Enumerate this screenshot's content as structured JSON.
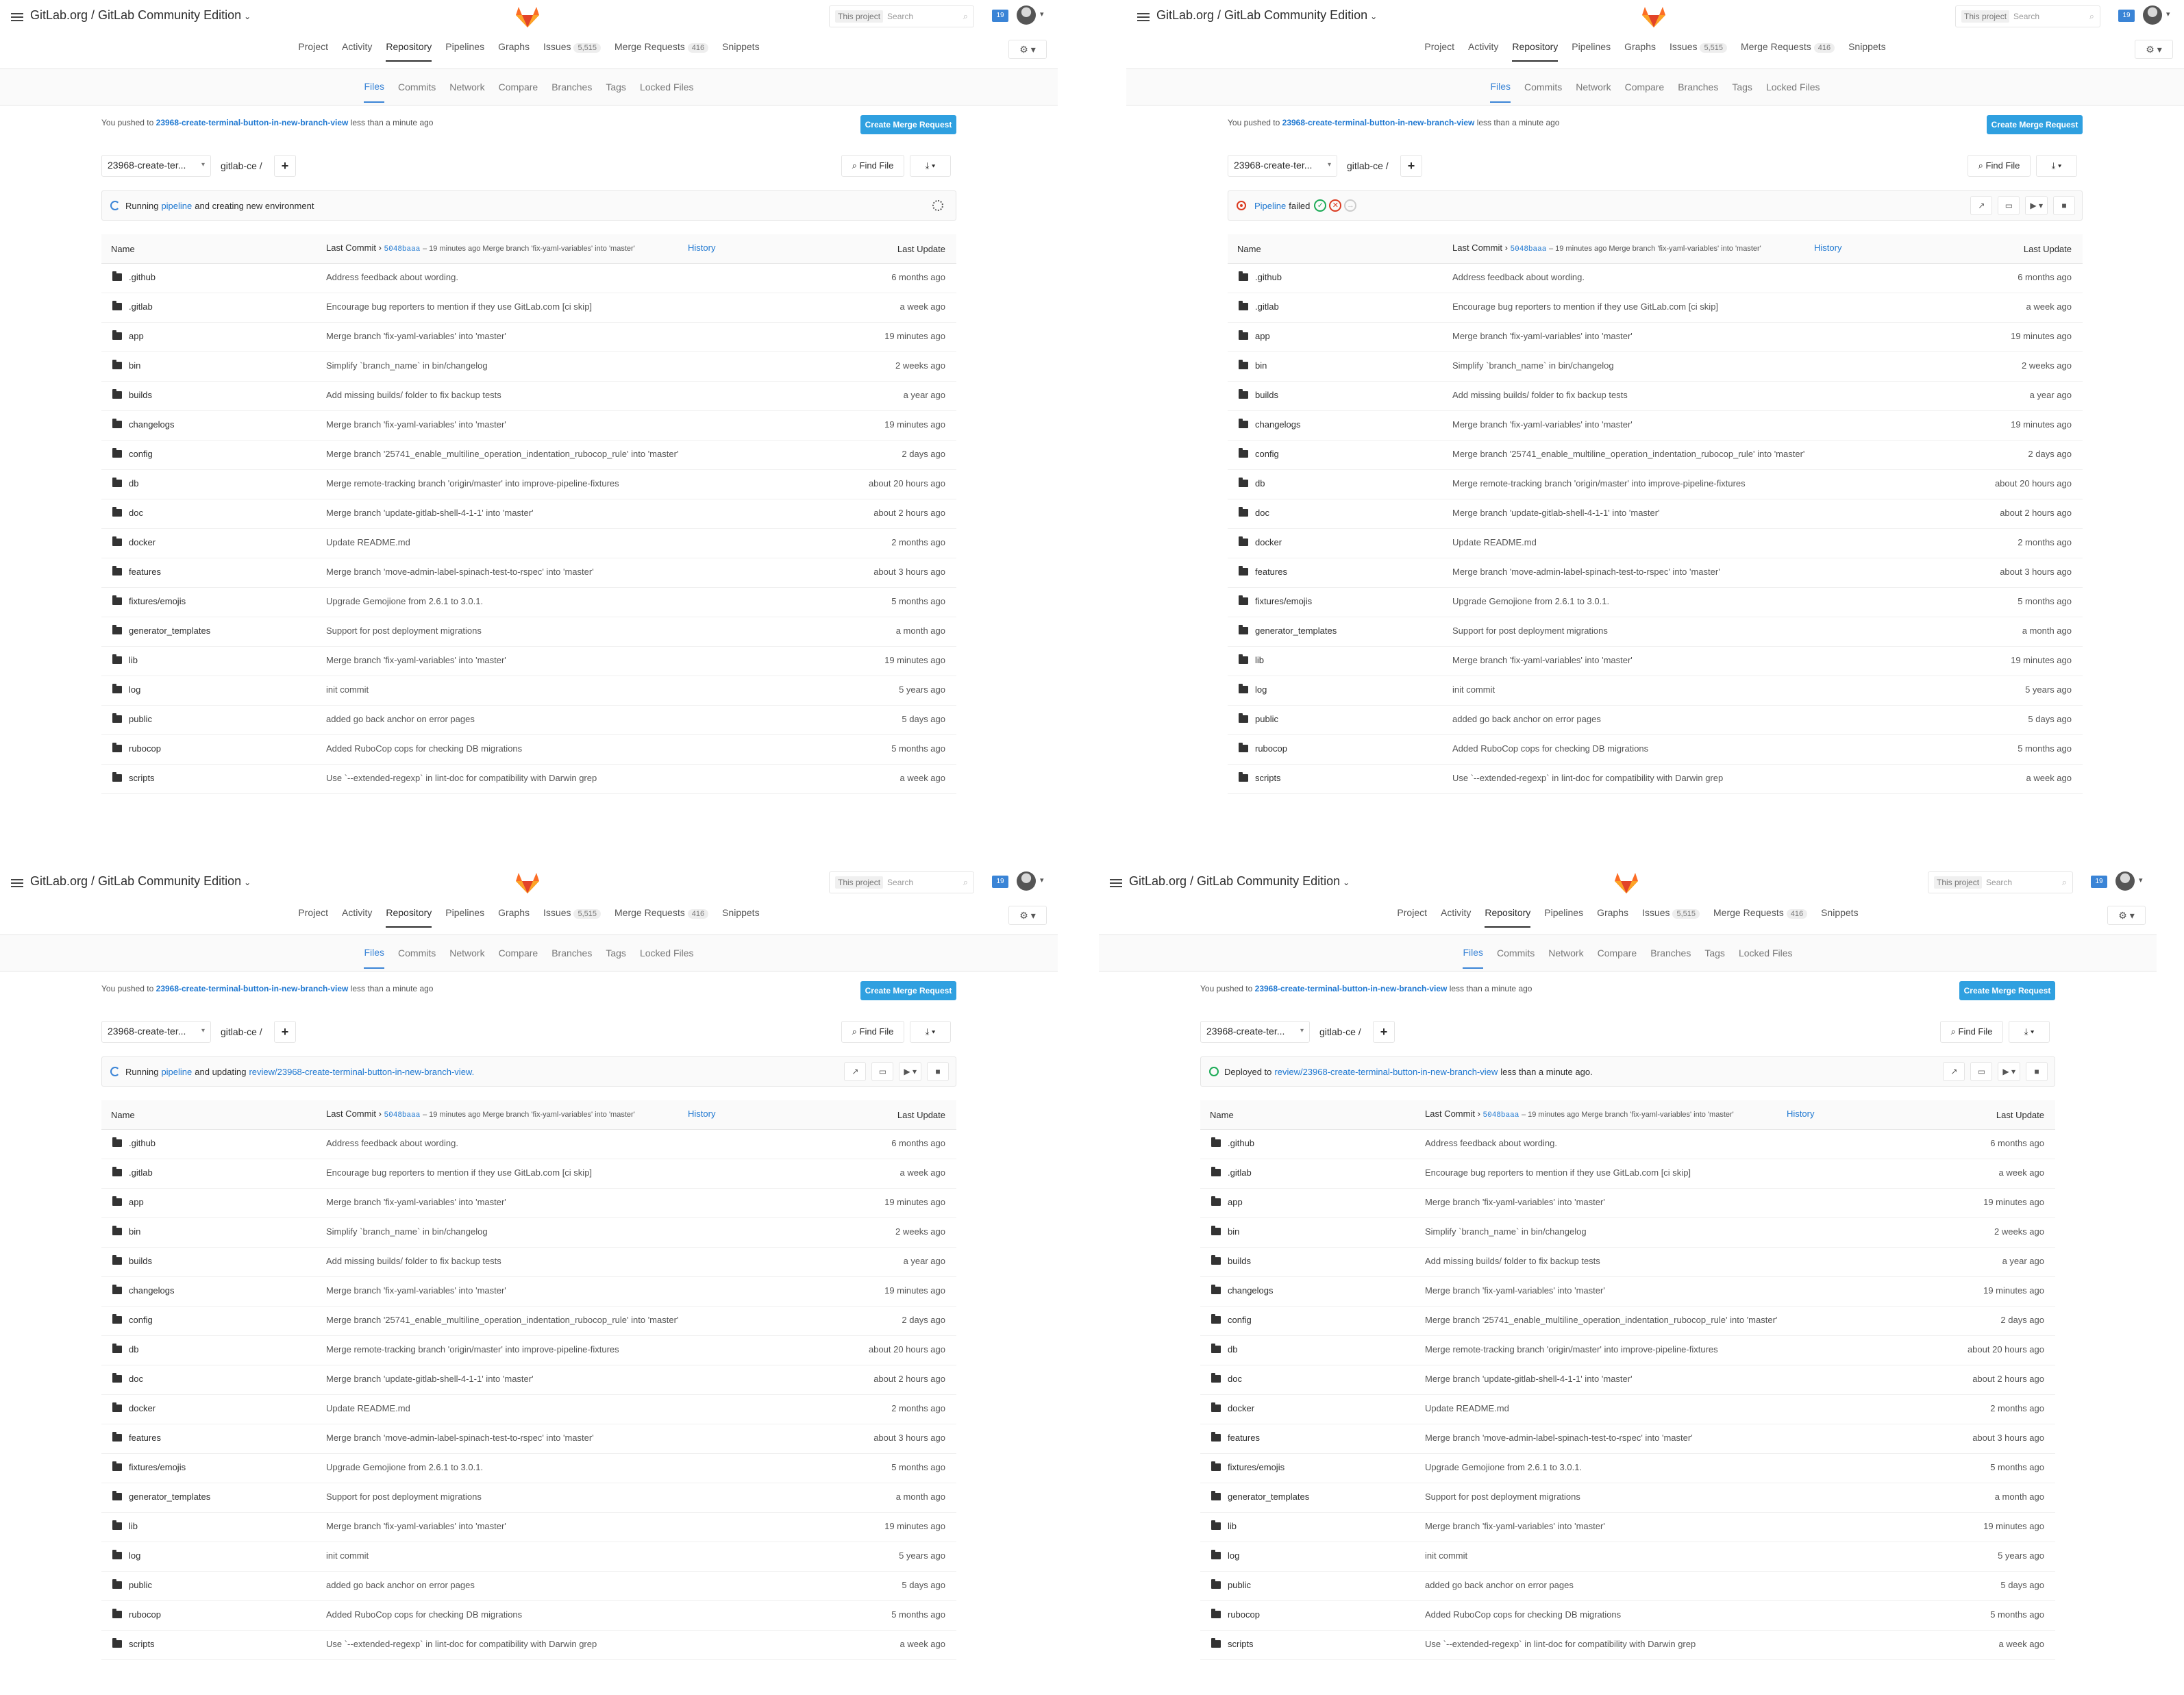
{
  "header": {
    "project_title": "GitLab.org / GitLab Community Edition",
    "search_scope": "This project",
    "search_placeholder": "Search",
    "todo_count": "19"
  },
  "nav": [
    {
      "label": "Project",
      "count": "",
      "active": false
    },
    {
      "label": "Activity",
      "count": "",
      "active": false
    },
    {
      "label": "Repository",
      "count": "",
      "active": true
    },
    {
      "label": "Pipelines",
      "count": "",
      "active": false
    },
    {
      "label": "Graphs",
      "count": "",
      "active": false
    },
    {
      "label": "Issues",
      "count": "5,515",
      "active": false
    },
    {
      "label": "Merge Requests",
      "count": "416",
      "active": false
    },
    {
      "label": "Snippets",
      "count": "",
      "active": false
    }
  ],
  "subnav": [
    {
      "label": "Files",
      "active": true
    },
    {
      "label": "Commits",
      "active": false
    },
    {
      "label": "Network",
      "active": false
    },
    {
      "label": "Compare",
      "active": false
    },
    {
      "label": "Branches",
      "active": false
    },
    {
      "label": "Tags",
      "active": false
    },
    {
      "label": "Locked Files",
      "active": false
    }
  ],
  "push_notice": {
    "prefix": "You pushed to",
    "branch": "23968-create-terminal-button-in-new-branch-view",
    "suffix": "less than a minute ago"
  },
  "create_mr_label": "Create Merge Request",
  "branch_selector": "23968-create-ter...",
  "path": "gitlab-ce /",
  "find_file_label": "Find File",
  "table_header": {
    "name": "Name",
    "last_commit": "Last Commit",
    "sha": "5048baaa",
    "commit_msg": "– 19 minutes ago Merge branch 'fix-yaml-variables' into 'master'",
    "history": "History",
    "last_update": "Last Update"
  },
  "status_panels": [
    {
      "type": "running",
      "text1": "Running",
      "link": "pipeline",
      "text2": "and creating new environment",
      "env_link": "",
      "text3": ""
    },
    {
      "type": "failed",
      "text1": "",
      "link": "Pipeline",
      "text2": "failed",
      "env_link": "",
      "text3": ""
    },
    {
      "type": "updating",
      "text1": "Running",
      "link": "pipeline",
      "text2": "and updating",
      "env_link": "review/23968-create-terminal-button-in-new-branch-view.",
      "text3": ""
    },
    {
      "type": "deployed",
      "text1": "Deployed to",
      "link": "",
      "text2": "",
      "env_link": "review/23968-create-terminal-button-in-new-branch-view",
      "text3": "less than a minute ago."
    }
  ],
  "files": [
    {
      "name": ".github",
      "commit": "Address feedback about wording.",
      "time": "6 months ago"
    },
    {
      "name": ".gitlab",
      "commit": "Encourage bug reporters to mention if they use GitLab.com [ci skip]",
      "time": "a week ago"
    },
    {
      "name": "app",
      "commit": "Merge branch 'fix-yaml-variables' into 'master'",
      "time": "19 minutes ago"
    },
    {
      "name": "bin",
      "commit": "Simplify `branch_name` in bin/changelog",
      "time": "2 weeks ago"
    },
    {
      "name": "builds",
      "commit": "Add missing builds/ folder to fix backup tests",
      "time": "a year ago"
    },
    {
      "name": "changelogs",
      "commit": "Merge branch 'fix-yaml-variables' into 'master'",
      "time": "19 minutes ago"
    },
    {
      "name": "config",
      "commit": "Merge branch '25741_enable_multiline_operation_indentation_rubocop_rule' into 'master'",
      "time": "2 days ago"
    },
    {
      "name": "db",
      "commit": "Merge remote-tracking branch 'origin/master' into improve-pipeline-fixtures",
      "time": "about 20 hours ago"
    },
    {
      "name": "doc",
      "commit": "Merge branch 'update-gitlab-shell-4-1-1' into 'master'",
      "time": "about 2 hours ago"
    },
    {
      "name": "docker",
      "commit": "Update README.md",
      "time": "2 months ago"
    },
    {
      "name": "features",
      "commit": "Merge branch 'move-admin-label-spinach-test-to-rspec' into 'master'",
      "time": "about 3 hours ago"
    },
    {
      "name": "fixtures/emojis",
      "commit": "Upgrade Gemojione from 2.6.1 to 3.0.1.",
      "time": "5 months ago"
    },
    {
      "name": "generator_templates",
      "commit": "Support for post deployment migrations",
      "time": "a month ago"
    },
    {
      "name": "lib",
      "commit": "Merge branch 'fix-yaml-variables' into 'master'",
      "time": "19 minutes ago"
    },
    {
      "name": "log",
      "commit": "init commit",
      "time": "5 years ago"
    },
    {
      "name": "public",
      "commit": "added go back anchor on error pages",
      "time": "5 days ago"
    },
    {
      "name": "rubocop",
      "commit": "Added RuboCop cops for checking DB migrations",
      "time": "5 months ago"
    },
    {
      "name": "scripts",
      "commit": "Use `--extended-regexp` in lint-doc for compatibility with Darwin grep",
      "time": "a week ago"
    }
  ]
}
